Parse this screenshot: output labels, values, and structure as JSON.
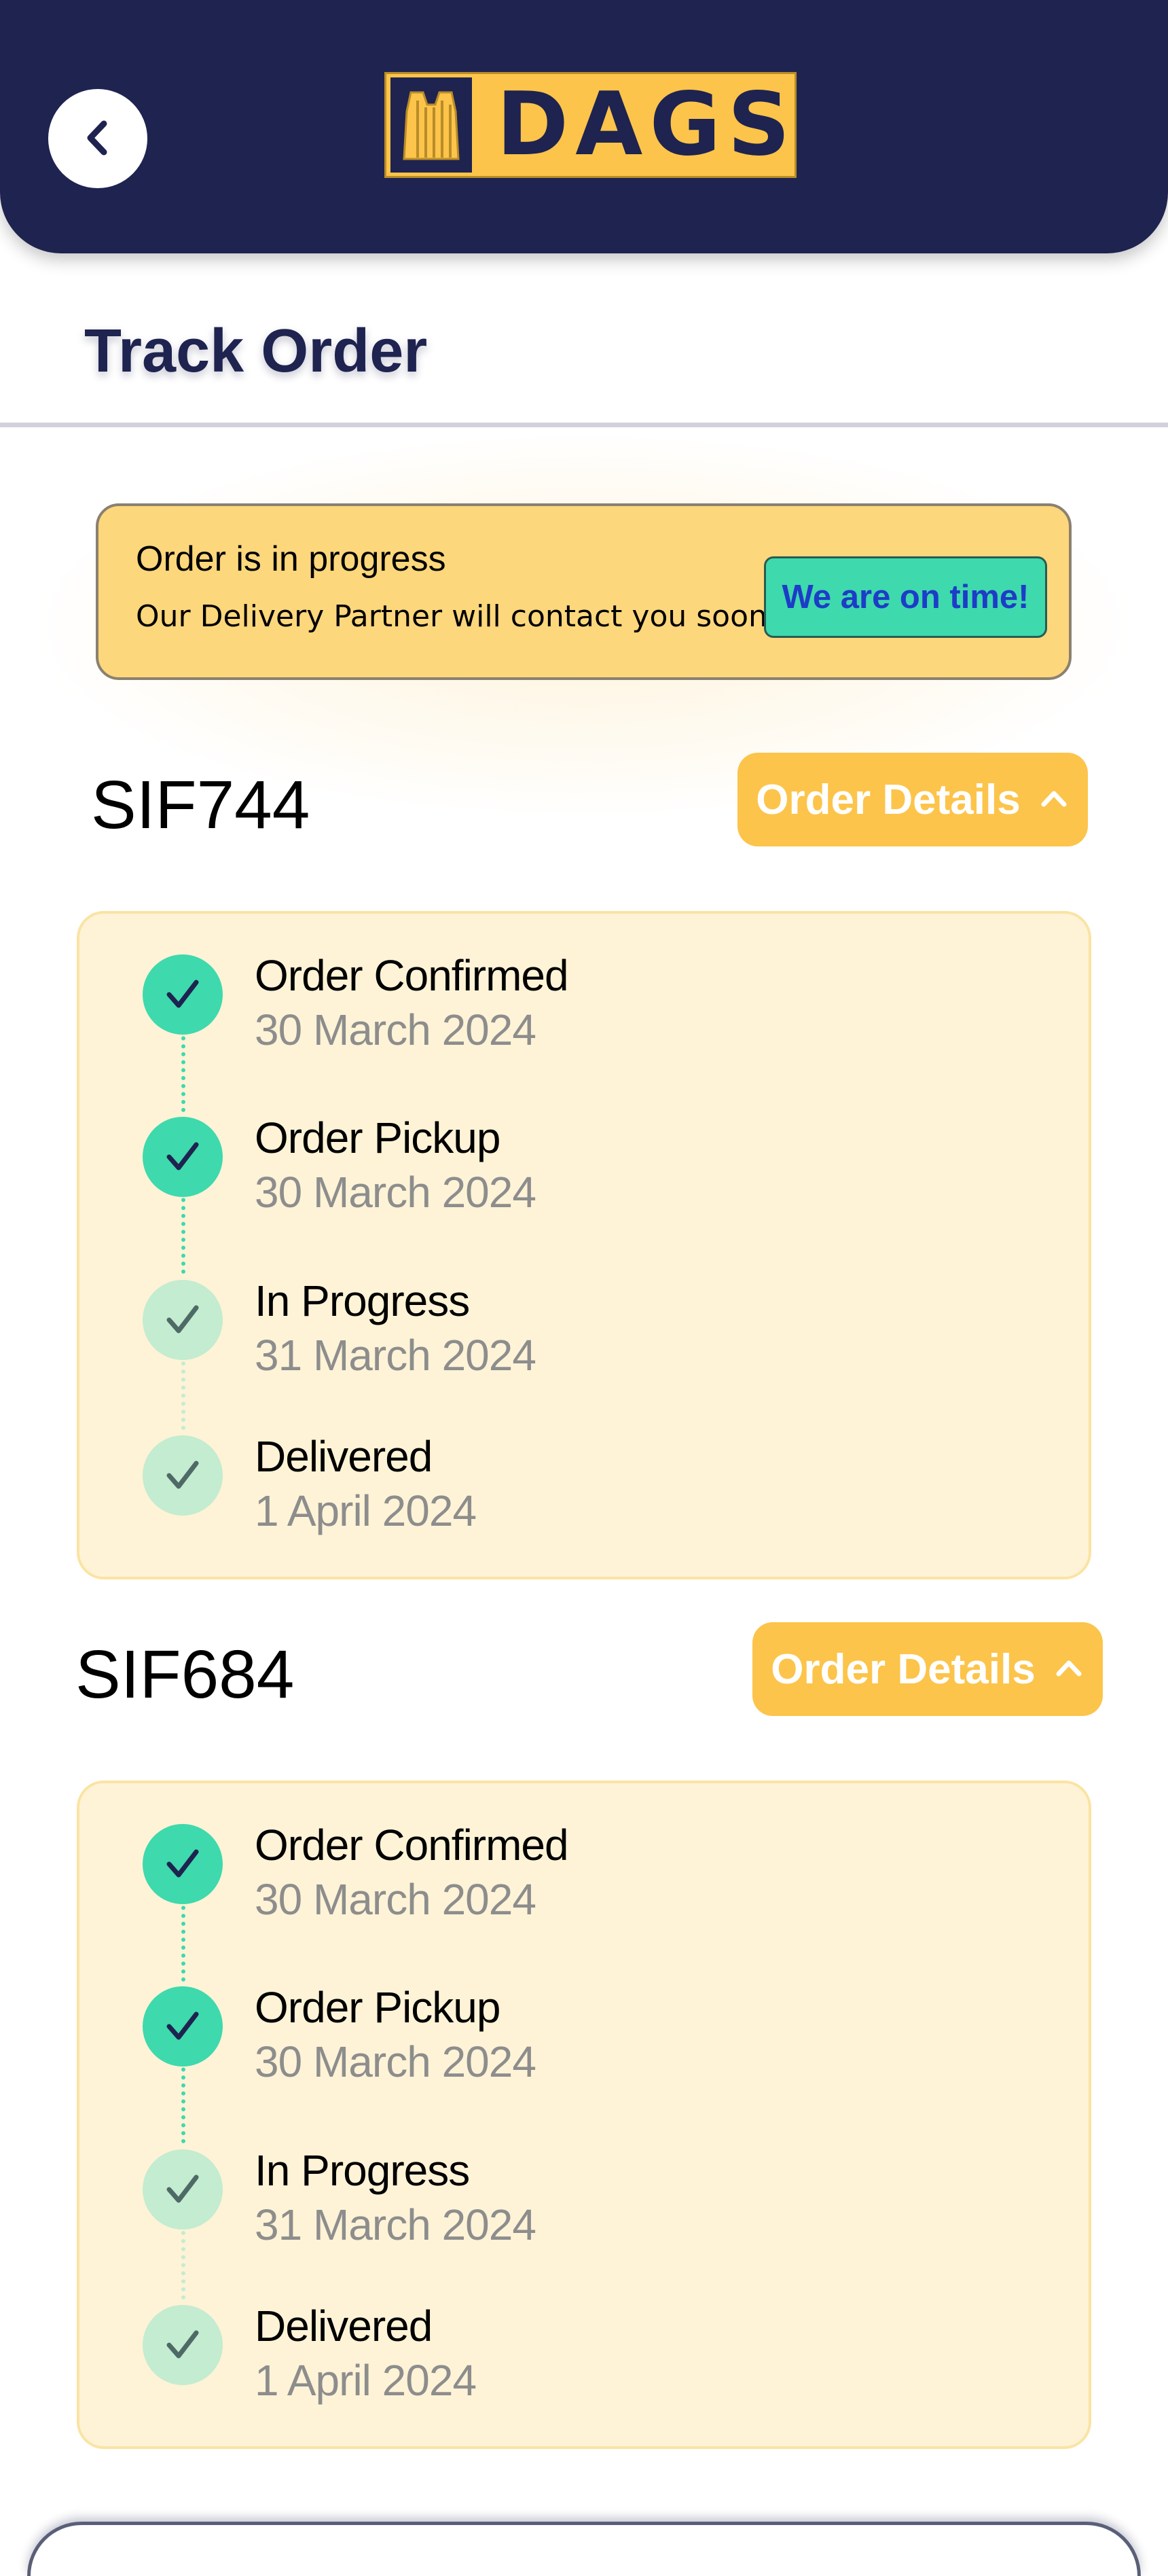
{
  "header": {
    "logo_text": "DAGS",
    "back_icon": "chevron-left-icon"
  },
  "page": {
    "title": "Track Order"
  },
  "status_banner": {
    "title": "Order is in progress",
    "subtitle": "Our Delivery Partner will contact you soon",
    "badge": "We are on time!"
  },
  "colors": {
    "navy": "#1e2350",
    "accent_yellow": "#fcc44a",
    "banner_yellow": "#fdd77c",
    "done_green": "#3ed9ad",
    "pending_green": "#c3ecd0",
    "card_bg": "#fef3d6"
  },
  "orders": [
    {
      "id": "SIF744",
      "details_label": "Order Details",
      "details_icon": "chevron-up-icon",
      "steps": [
        {
          "label": "Order Confirmed",
          "date": "30 March 2024",
          "status": "done"
        },
        {
          "label": "Order Pickup",
          "date": "30 March 2024",
          "status": "done"
        },
        {
          "label": "In Progress",
          "date": "31 March 2024",
          "status": "pending"
        },
        {
          "label": "Delivered",
          "date": "1 April 2024",
          "status": "pending"
        }
      ]
    },
    {
      "id": "SIF684",
      "details_label": "Order Details",
      "details_icon": "chevron-up-icon",
      "steps": [
        {
          "label": "Order Confirmed",
          "date": "30 March 2024",
          "status": "done"
        },
        {
          "label": "Order Pickup",
          "date": "30 March 2024",
          "status": "done"
        },
        {
          "label": "In Progress",
          "date": "31 March 2024",
          "status": "pending"
        },
        {
          "label": "Delivered",
          "date": "1 April 2024",
          "status": "pending"
        }
      ]
    }
  ]
}
